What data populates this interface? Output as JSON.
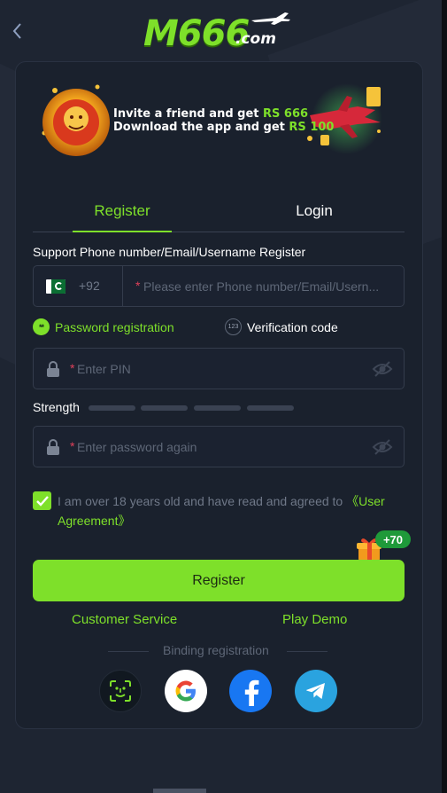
{
  "header": {
    "logo_main": "M666",
    "logo_domain": ".com"
  },
  "banner": {
    "line1_prefix": "Invite a friend and get ",
    "line1_amount": "RS 666",
    "line2_prefix": "Download the app and get ",
    "line2_amount": "RS 100"
  },
  "tabs": {
    "register": "Register",
    "login": "Login",
    "active": "register"
  },
  "form": {
    "support_label": "Support Phone number/Email/Username Register",
    "country_code": "+92",
    "account_placeholder": "Please enter Phone number/Email/Usern...",
    "mode_password": "Password registration",
    "mode_verification": "Verification code",
    "mode_password_icon_text": "**",
    "mode_verification_icon_text": "123",
    "pin_placeholder": "Enter PIN",
    "strength_label": "Strength",
    "confirm_placeholder": "Enter password again",
    "agree_text": "I am over 18 years old and have read and agreed to ",
    "agree_link": "《User Agreement》",
    "agree_checked": true
  },
  "gift_badge": "+70",
  "register_button": "Register",
  "links": {
    "customer_service": "Customer Service",
    "play_demo": "Play Demo"
  },
  "binding_label": "Binding registration",
  "social_icons": [
    "face-id-icon",
    "google-icon",
    "facebook-icon",
    "telegram-icon"
  ],
  "colors": {
    "accent": "#7ee02a",
    "background": "#1e2532",
    "card": "#1a212d",
    "required_star": "#e0405a"
  }
}
